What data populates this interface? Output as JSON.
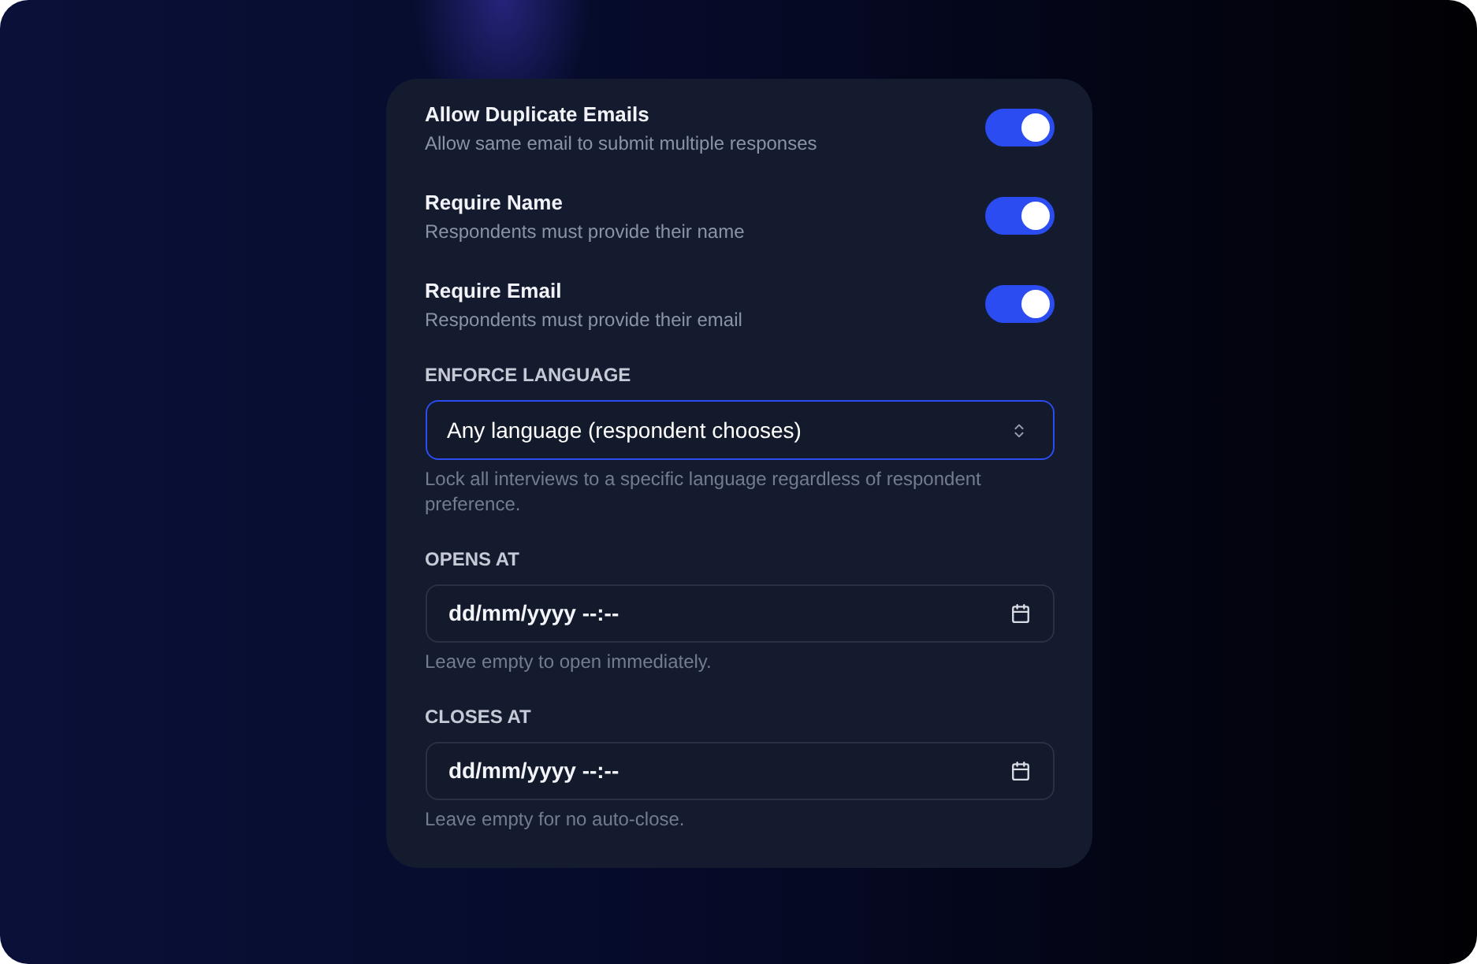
{
  "toggles": [
    {
      "label": "Allow Duplicate Emails",
      "description": "Allow same email to submit multiple responses",
      "on": true
    },
    {
      "label": "Require Name",
      "description": "Respondents must provide their name",
      "on": true
    },
    {
      "label": "Require Email",
      "description": "Respondents must provide their email",
      "on": true
    }
  ],
  "fields": [
    {
      "kind": "select",
      "label": "ENFORCE LANGUAGE",
      "value": "Any language (respondent chooses)",
      "focused": true,
      "help": "Lock all interviews to a specific language regardless of respondent preference."
    },
    {
      "kind": "datetime",
      "label": "OPENS AT",
      "placeholder": "dd/mm/yyyy --:--",
      "focused": false,
      "help": "Leave empty to open immediately."
    },
    {
      "kind": "datetime",
      "label": "CLOSES AT",
      "placeholder": "dd/mm/yyyy --:--",
      "focused": false,
      "help": "Leave empty for no auto-close."
    }
  ]
}
